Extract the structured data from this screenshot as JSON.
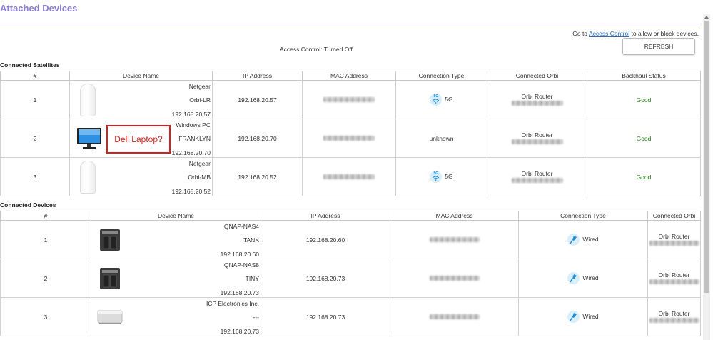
{
  "page_title": "Attached Devices",
  "goto": {
    "prefix": "Go to",
    "link": "Access Control",
    "suffix": "to allow or block devices."
  },
  "access_control_status": "Access Control: Turned Off",
  "refresh_label": "REFRESH",
  "satellites": {
    "title": "Connected Satellites",
    "headers": [
      "#",
      "Device Name",
      "IP Address",
      "MAC Address",
      "Connection Type",
      "Connected Orbi",
      "Backhaul Status"
    ],
    "rows": [
      {
        "num": "1",
        "name_lines": [
          "Netgear",
          "Orbi-LR",
          "192.168.20.57"
        ],
        "ip": "192.168.20.57",
        "connection": "5G",
        "orbi": "Orbi Router",
        "status": "Good",
        "icon": "orbi-satellite-icon"
      },
      {
        "num": "2",
        "name_lines": [
          "Windows PC",
          "FRANKLYN",
          "192.168.20.70"
        ],
        "ip": "192.168.20.70",
        "connection": "unknown",
        "orbi": "Orbi Router",
        "status": "Good",
        "icon": "monitor-icon"
      },
      {
        "num": "3",
        "name_lines": [
          "Netgear",
          "Orbi-MB",
          "192.168.20.52"
        ],
        "ip": "192.168.20.52",
        "connection": "5G",
        "orbi": "Orbi Router",
        "status": "Good",
        "icon": "orbi-satellite-icon"
      }
    ]
  },
  "devices": {
    "title": "Connected Devices",
    "headers": [
      "#",
      "Device Name",
      "IP Address",
      "MAC Address",
      "Connection Type",
      "Connected Orbi"
    ],
    "rows": [
      {
        "num": "1",
        "name_lines": [
          "QNAP-NAS4",
          "TANK",
          "192.168.20.60"
        ],
        "ip": "192.168.20.60",
        "connection": "Wired",
        "orbi": "Orbi Router",
        "icon": "nas-icon"
      },
      {
        "num": "2",
        "name_lines": [
          "QNAP-NAS8",
          "TINY",
          "192.168.20.73"
        ],
        "ip": "192.168.20.73",
        "connection": "Wired",
        "orbi": "Orbi Router",
        "icon": "nas-icon"
      },
      {
        "num": "3",
        "name_lines": [
          "ICP Electronics Inc.",
          "---",
          "192.168.20.73"
        ],
        "ip": "192.168.20.73",
        "connection": "Wired",
        "orbi": "Orbi Router",
        "icon": "mini-pc-icon"
      }
    ]
  },
  "callout_text": "Dell Laptop?",
  "colors": {
    "title": "#8a7fd4",
    "good": "#2b7a1f",
    "callout": "#d61f1f",
    "link": "#2a6ebb"
  }
}
